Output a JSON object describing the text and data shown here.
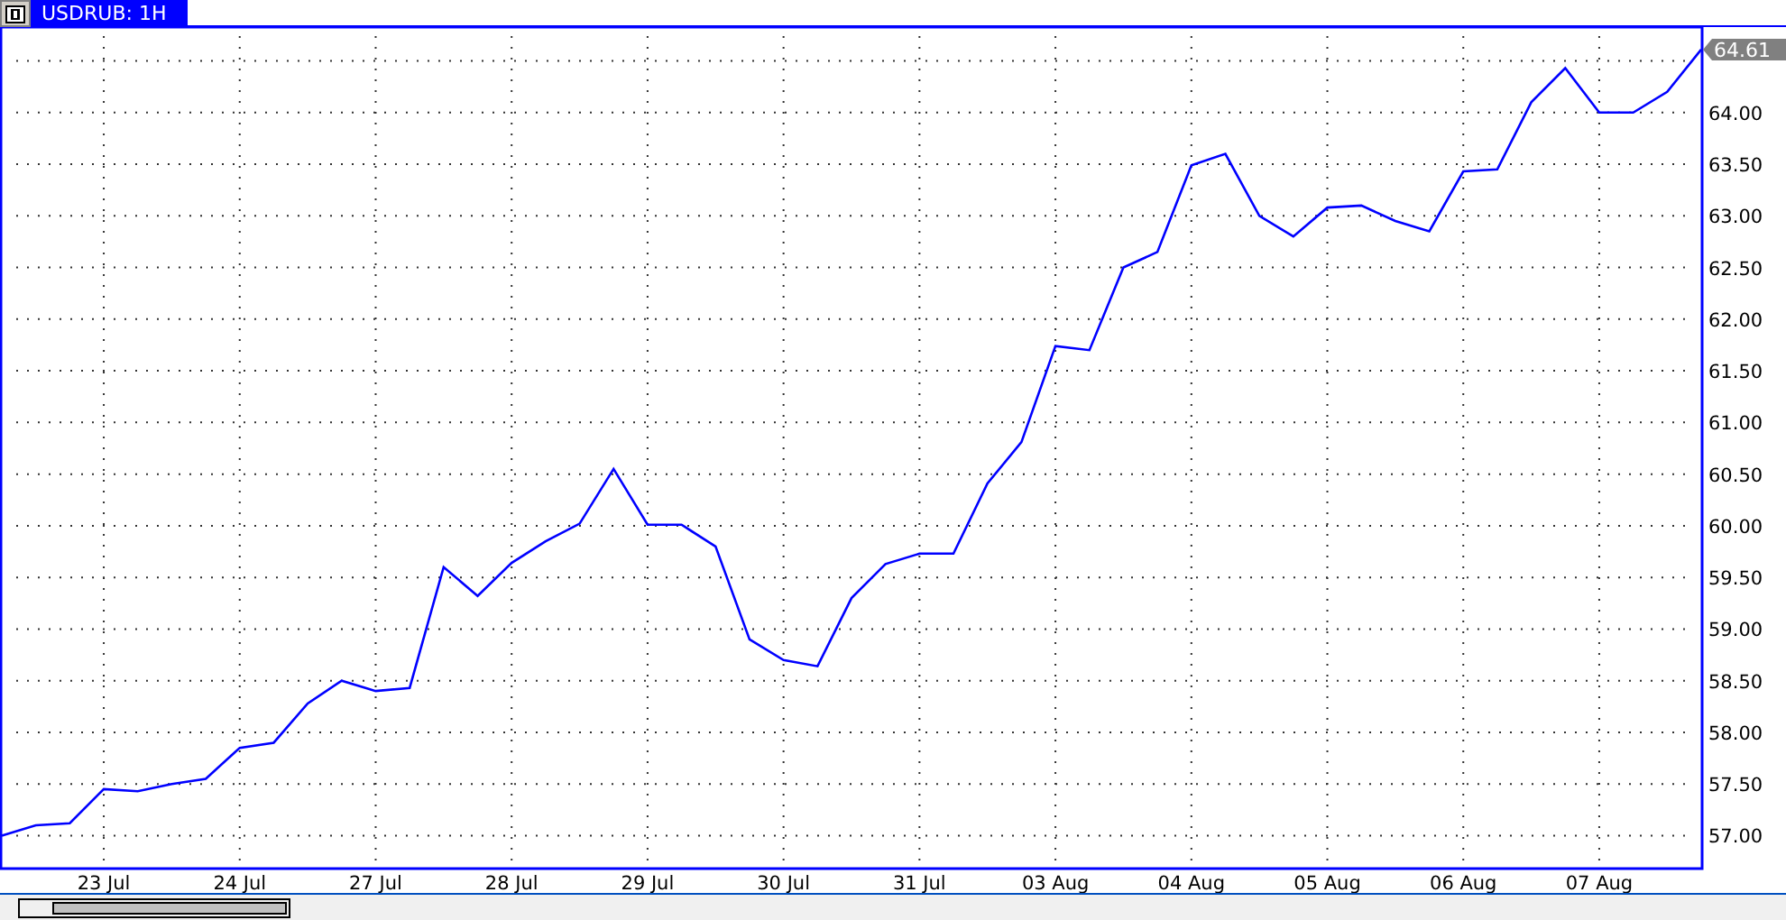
{
  "window": {
    "tab_title": "USDRUB: 1H"
  },
  "chart": {
    "current_price": "64.61",
    "chart_data": {
      "type": "line",
      "categories": [
        null,
        null,
        null,
        "23 Jul",
        null,
        null,
        null,
        "24 Jul",
        null,
        null,
        null,
        "27 Jul",
        null,
        null,
        null,
        "28 Jul",
        null,
        null,
        null,
        "29 Jul",
        null,
        null,
        null,
        "30 Jul",
        null,
        null,
        null,
        "31 Jul",
        null,
        null,
        null,
        "03 Aug",
        null,
        null,
        null,
        "04 Aug",
        null,
        null,
        null,
        "05 Aug",
        null,
        null,
        null,
        "06 Aug",
        null,
        null,
        null,
        "07 Aug",
        null,
        null,
        null
      ],
      "series": [
        {
          "color": "#0000ff",
          "values": [
            57.0,
            57.1,
            57.12,
            57.45,
            57.43,
            57.5,
            57.55,
            57.85,
            57.9,
            58.28,
            58.5,
            58.4,
            58.43,
            59.6,
            59.32,
            59.64,
            59.85,
            60.02,
            60.55,
            60.01,
            60.01,
            59.8,
            58.9,
            58.7,
            58.64,
            59.3,
            59.63,
            59.73,
            59.73,
            60.41,
            60.81,
            61.74,
            61.7,
            62.5,
            62.65,
            63.49,
            63.6,
            63.0,
            62.8,
            63.08,
            63.1,
            62.95,
            62.85,
            63.43,
            63.45,
            64.1,
            64.43,
            64.0,
            64.0,
            64.2,
            64.61
          ]
        }
      ],
      "grid": true,
      "ylim": [
        56.69,
        64.81
      ],
      "yticks": [
        {
          "value": 57,
          "label": "57.00"
        },
        {
          "value": 57.5,
          "label": "57.50"
        },
        {
          "value": 58,
          "label": "58.00"
        },
        {
          "value": 58.5,
          "label": "58.50"
        },
        {
          "value": 59,
          "label": "59.00"
        },
        {
          "value": 59.5,
          "label": "59.50"
        },
        {
          "value": 60,
          "label": "60.00"
        },
        {
          "value": 60.5,
          "label": "60.50"
        },
        {
          "value": 61,
          "label": "61.00"
        },
        {
          "value": 61.5,
          "label": "61.50"
        },
        {
          "value": 62,
          "label": "62.00"
        },
        {
          "value": 62.5,
          "label": "62.50"
        },
        {
          "value": 63,
          "label": "63.00"
        },
        {
          "value": 63.5,
          "label": "63.50"
        },
        {
          "value": 64,
          "label": "64.00"
        }
      ]
    }
  }
}
